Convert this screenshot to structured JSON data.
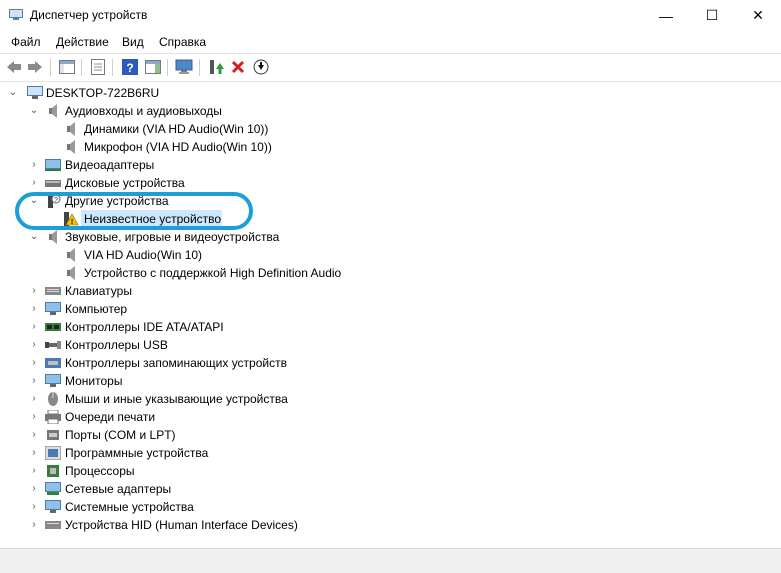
{
  "window": {
    "title": "Диспетчер устройств",
    "minimize": "—",
    "maximize": "☐",
    "close": "✕"
  },
  "menu": [
    "Файл",
    "Действие",
    "Вид",
    "Справка"
  ],
  "tree": {
    "root": "DESKTOP-722B6RU",
    "audio_io": {
      "label": "Аудиовходы и аудиовыходы",
      "children": [
        "Динамики (VIA HD Audio(Win 10))",
        "Микрофон (VIA HD Audio(Win 10))"
      ]
    },
    "video_adapters": "Видеоадаптеры",
    "disk_devices": "Дисковые устройства",
    "other_devices": {
      "label": "Другие устройства",
      "children": [
        "Неизвестное устройство"
      ]
    },
    "sound_devices": {
      "label": "Звуковые, игровые и видеоустройства",
      "children": [
        "VIA HD Audio(Win 10)",
        "Устройство с поддержкой High Definition Audio"
      ]
    },
    "collapsed": [
      "Клавиатуры",
      "Компьютер",
      "Контроллеры IDE ATA/ATAPI",
      "Контроллеры USB",
      "Контроллеры запоминающих устройств",
      "Мониторы",
      "Мыши и иные указывающие устройства",
      "Очереди печати",
      "Порты (COM и LPT)",
      "Программные устройства",
      "Процессоры",
      "Сетевые адаптеры",
      "Системные устройства",
      "Устройства HID (Human Interface Devices)"
    ]
  },
  "colors": {
    "selection": "#cce8ff",
    "annotation_ring": "#1a9fd9",
    "delete_red": "#d61f1f",
    "toolbar_green": "#2e9b3a"
  }
}
